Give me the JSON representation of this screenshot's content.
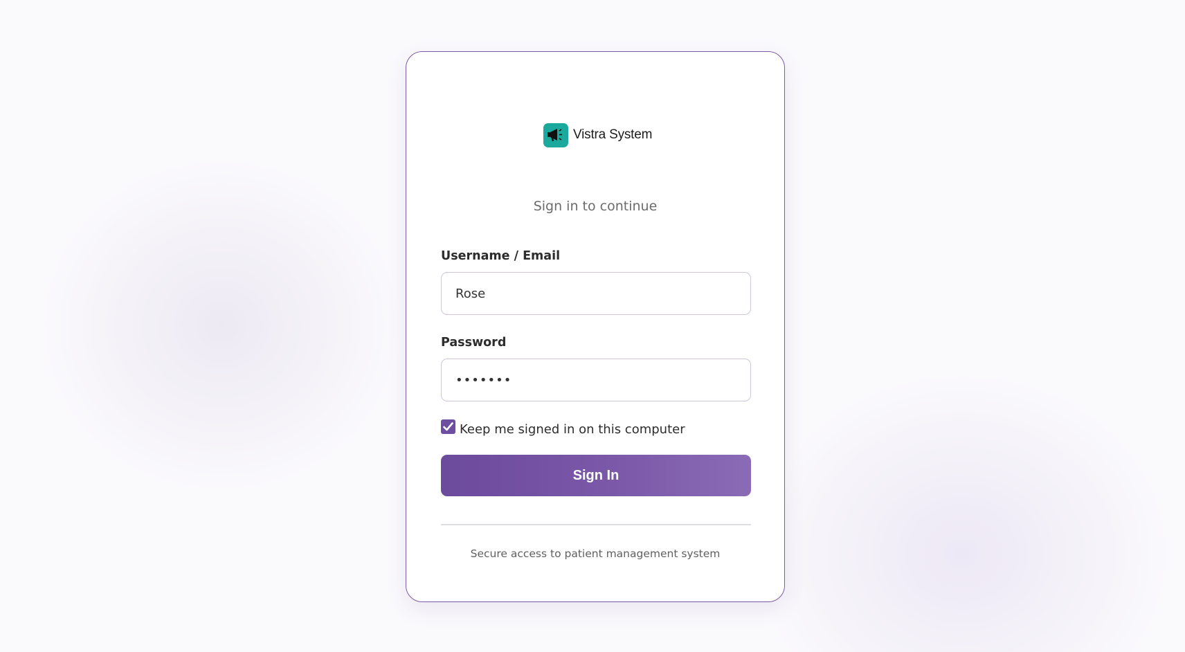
{
  "brand": {
    "name": "Vistra System",
    "logo_icon": "megaphone-icon",
    "logo_color": "#1aa99c"
  },
  "login": {
    "subtitle": "Sign in to continue",
    "username_label": "Username / Email",
    "username_value": "Rose",
    "password_label": "Password",
    "password_value": "•••••••",
    "remember_label": "Keep me signed in on this computer",
    "remember_checked": true,
    "submit_label": "Sign In",
    "footer_text": "Secure access to patient management system"
  },
  "colors": {
    "accent": "#6e4f9f",
    "card_border": "#7a5ba5"
  }
}
